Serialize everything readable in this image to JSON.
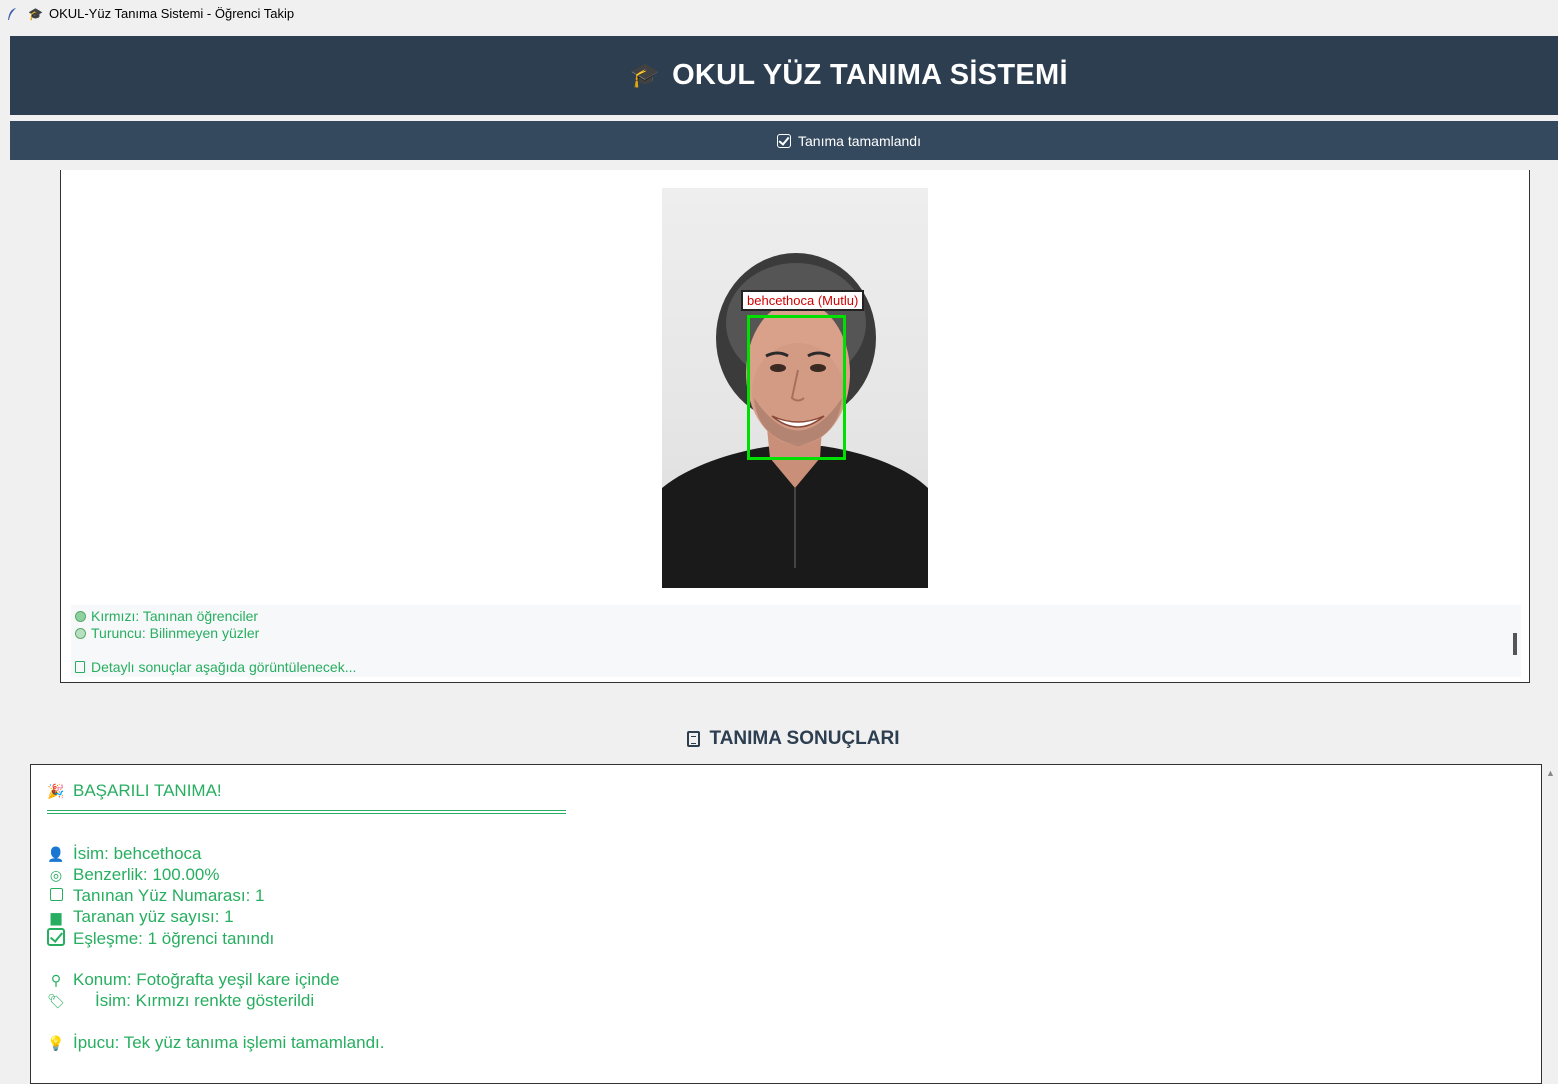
{
  "window": {
    "title": "OKUL-Yüz Tanıma Sistemi - Öğrenci Takip",
    "title_icon": "graduation-cap-icon"
  },
  "header": {
    "title": "OKUL YÜZ TANIMA SİSTEMİ",
    "icon": "graduation-cap-icon"
  },
  "status": {
    "text": "Tanıma tamamlandı",
    "icon": "checkbox-icon"
  },
  "preview": {
    "face_label": "behcethoca (Mutlu)",
    "legend": {
      "red": "Kırmızı: Tanınan öğrenciler",
      "orange": "Turuncu: Bilinmeyen yüzler",
      "details": "Detaylı sonuçlar aşağıda görüntülenecek..."
    }
  },
  "results": {
    "title": "TANIMA SONUÇLARI",
    "success": "BAŞARILI TANIMA!",
    "name": "İsim: behcethoca",
    "similarity": "Benzerlik: 100.00%",
    "face_number": "Tanınan Yüz Numarası: 1",
    "scanned": "Taranan yüz sayısı: 1",
    "match": "Eşleşme: 1 öğrenci tanındı",
    "location": "Konum: Fotoğrafta yeşil kare içinde",
    "name_color": "İsim: Kırmızı renkte gösterildi",
    "tip": "İpucu: Tek yüz tanıma işlemi tamamlandı."
  },
  "colors": {
    "header_bg": "#2c3e50",
    "status_bg": "#34495e",
    "result_text": "#27ae60",
    "face_box": "#00e000",
    "face_label_text": "#d00000"
  }
}
